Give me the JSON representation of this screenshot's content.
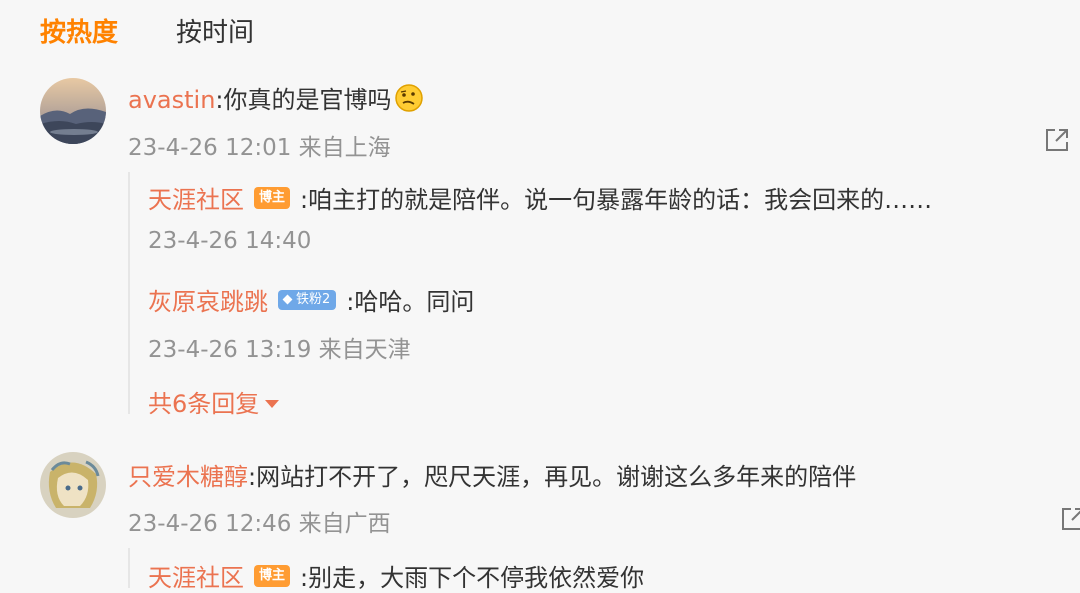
{
  "tabs": [
    {
      "label": "按热度",
      "active": true
    },
    {
      "label": "按时间",
      "active": false
    }
  ],
  "accent": "#ff8200",
  "username_color": "#eb7350",
  "comments": [
    {
      "user": "avastin",
      "text": ":你真的是官博吗",
      "emoji": "thinking-face-emoji",
      "time": "23-4-26 12:01",
      "location": "来自上海",
      "replies": [
        {
          "user": "天涯社区",
          "badge": "博主",
          "text": ":咱主打的就是陪伴。说一句暴露年龄的话：我会回来的……",
          "time": "23-4-26 14:40",
          "location": ""
        },
        {
          "user": "灰原哀跳跳",
          "badge": "铁粉2",
          "text": ":哈哈。同问",
          "time": "23-4-26 13:19",
          "location": "来自天津"
        }
      ],
      "more_label": "共6条回复"
    },
    {
      "user": "只爱木糖醇",
      "text": ":网站打不开了，咫尺天涯，再见。谢谢这么多年来的陪伴",
      "time": "23-4-26 12:46",
      "location": "来自广西",
      "replies": [
        {
          "user": "天涯社区",
          "badge": "博主",
          "text": ":别走，大雨下个不停我依然爱你"
        }
      ]
    }
  ]
}
